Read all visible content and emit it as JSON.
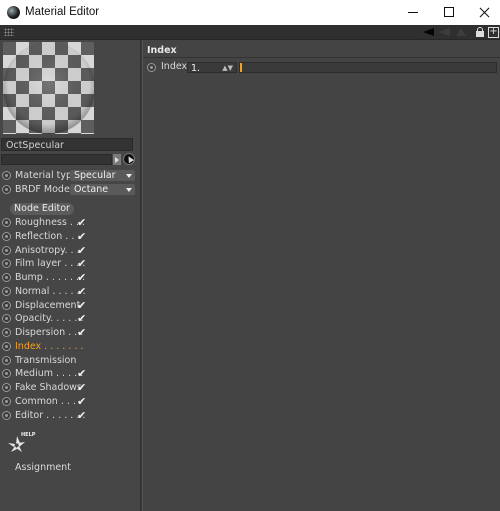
{
  "window": {
    "title": "Material Editor"
  },
  "material": {
    "name": "OctSpecular",
    "material_type_label": "Material type",
    "material_type_value": "Specular",
    "brdf_label": "BRDF Model",
    "brdf_value": "Octane"
  },
  "node_editor_label": "Node Editor",
  "channels": [
    {
      "label": "Roughness",
      "dots": " . . .",
      "checked": true,
      "active": false
    },
    {
      "label": "Reflection",
      "dots": " . . .",
      "checked": true,
      "active": false
    },
    {
      "label": "Anisotropy",
      "dots": ". . .",
      "checked": true,
      "active": false
    },
    {
      "label": "Film layer",
      "dots": " . . . .",
      "checked": true,
      "active": false
    },
    {
      "label": "Bump",
      "dots": " . . . . . . .",
      "checked": true,
      "active": false
    },
    {
      "label": "Normal",
      "dots": " . . . . . .",
      "checked": true,
      "active": false
    },
    {
      "label": "Displacement",
      "dots": "",
      "checked": true,
      "active": false
    },
    {
      "label": "Opacity",
      "dots": ". . . . . .",
      "checked": true,
      "active": false
    },
    {
      "label": "Dispersion",
      "dots": " . . .",
      "checked": true,
      "active": false
    },
    {
      "label": "Index",
      "dots": " . . . . . . .",
      "checked": false,
      "active": true
    },
    {
      "label": "Transmission",
      "dots": "",
      "checked": false,
      "active": false
    },
    {
      "label": "Medium",
      "dots": " . . . . .",
      "checked": true,
      "active": false
    },
    {
      "label": "Fake Shadows",
      "dots": "",
      "checked": true,
      "active": false
    },
    {
      "label": "Common",
      "dots": " . . . .",
      "checked": true,
      "active": false
    },
    {
      "label": "Editor",
      "dots": " . . . . . . .",
      "checked": true,
      "active": false
    }
  ],
  "help_label": "HELP",
  "assignment_label": "Assignment",
  "index_panel": {
    "title": "Index",
    "param_label": "Index",
    "value": "1.",
    "slider_fraction": 0
  },
  "colors": {
    "accent": "#f4a223",
    "background": "#444444"
  }
}
